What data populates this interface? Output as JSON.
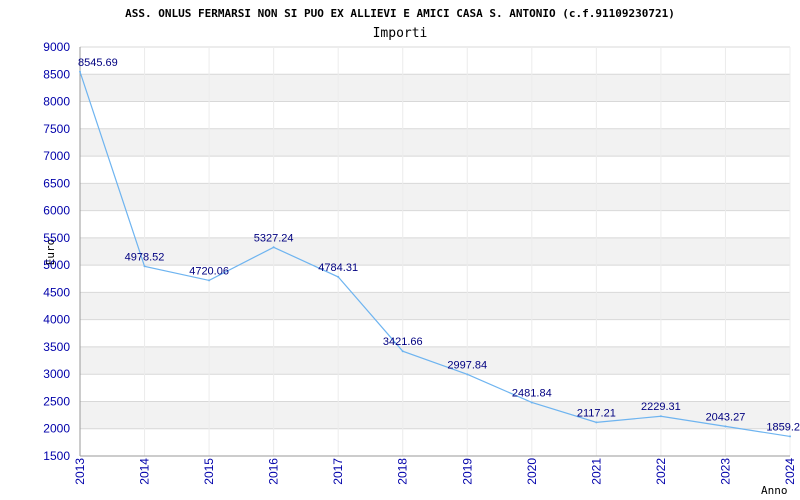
{
  "chart_data": {
    "type": "line",
    "title": "ASS. ONLUS FERMARSI NON SI PUO EX ALLIEVI E AMICI CASA S. ANTONIO (c.f.91109230721)",
    "subtitle": "Importi",
    "xlabel": "Anno",
    "ylabel": "Euro",
    "x": [
      "2013",
      "2014",
      "2015",
      "2016",
      "2017",
      "2018",
      "2019",
      "2020",
      "2021",
      "2022",
      "2023",
      "2024"
    ],
    "y": [
      8545.69,
      4978.52,
      4720.06,
      5327.24,
      4784.31,
      3421.66,
      2997.84,
      2481.84,
      2117.21,
      2229.31,
      2043.27,
      1859.2
    ],
    "data_labels": [
      "8545.69",
      "4978.52",
      "4720.06",
      "5327.24",
      "4784.31",
      "3421.66",
      "2997.84",
      "2481.84",
      "2117.21",
      "2229.31",
      "2043.27",
      "1859.2"
    ],
    "ylim": [
      1500,
      9000
    ],
    "yticks": [
      "1500",
      "2000",
      "2500",
      "3000",
      "3500",
      "4000",
      "4500",
      "5000",
      "5500",
      "6000",
      "6500",
      "7000",
      "7500",
      "8000",
      "8500",
      "9000"
    ],
    "grid": true,
    "line_color": "#6eb4f0",
    "band_color": "#f2f2f2",
    "tick_color": "#0000aa",
    "label_color": "#000080"
  }
}
